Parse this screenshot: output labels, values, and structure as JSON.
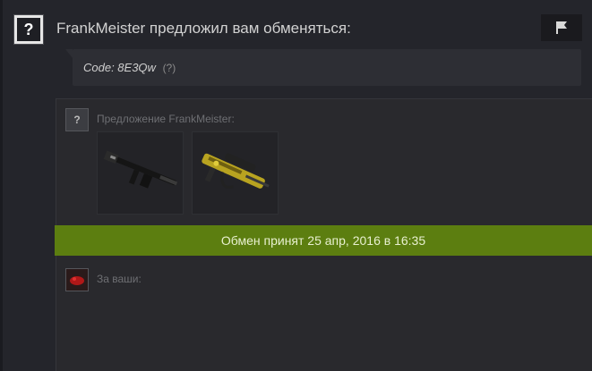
{
  "header": {
    "text": "FrankMeister предложил вам обменяться:",
    "avatar_glyph": "?",
    "flag_icon": "flag-icon"
  },
  "code_box": {
    "code_text": "Code: 8E3Qw",
    "help_text": "(?)"
  },
  "offer": {
    "avatar_glyph": "?",
    "label": "Предложение FrankMeister:",
    "items": [
      {
        "name": "ak-rifle",
        "color": "#1b1b1b"
      },
      {
        "name": "famas-rifle",
        "color": "#b8a320"
      }
    ]
  },
  "status": {
    "text": "Обмен принят 25 апр, 2016 в 16:35",
    "color": "#5c7e10"
  },
  "yours": {
    "label": "За ваши:"
  }
}
